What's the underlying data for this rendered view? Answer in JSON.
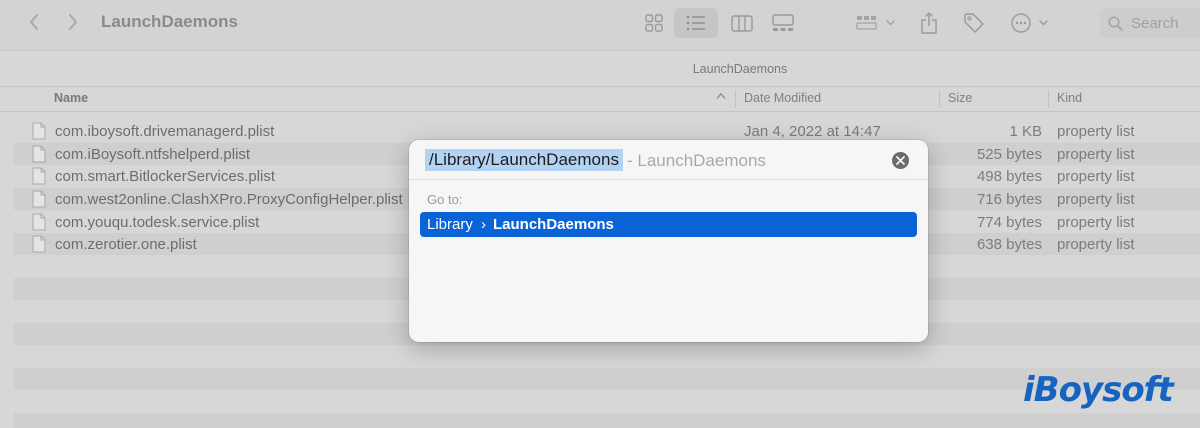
{
  "window": {
    "title": "LaunchDaemons",
    "path_bar": "LaunchDaemons",
    "search_placeholder": "Search"
  },
  "toolbar": {
    "icons": [
      "chevron-left-icon",
      "chevron-right-icon",
      "icon-view-icon",
      "list-view-icon",
      "column-view-icon",
      "gallery-view-icon",
      "group-icon",
      "share-icon",
      "tag-icon",
      "more-actions-icon",
      "search-icon"
    ],
    "active_view": "list-view"
  },
  "columns": {
    "name": "Name",
    "date_modified": "Date Modified",
    "size": "Size",
    "kind": "Kind"
  },
  "files": [
    {
      "name": "com.iboysoft.drivemanagerd.plist",
      "date": "Jan 4, 2022 at 14:47",
      "size": "1 KB",
      "kind": "property list"
    },
    {
      "name": "com.iBoysoft.ntfshelperd.plist",
      "date": "",
      "size": "525 bytes",
      "kind": "property list"
    },
    {
      "name": "com.smart.BitlockerServices.plist",
      "date": "",
      "size": "498 bytes",
      "kind": "property list"
    },
    {
      "name": "com.west2online.ClashXPro.ProxyConfigHelper.plist",
      "date": "",
      "size": "716 bytes",
      "kind": "property list"
    },
    {
      "name": "com.youqu.todesk.service.plist",
      "date": "",
      "size": "774 bytes",
      "kind": "property list"
    },
    {
      "name": "com.zerotier.one.plist",
      "date": "",
      "size": "638 bytes",
      "kind": "property list"
    }
  ],
  "goto_dialog": {
    "typed_path": "/Library/LaunchDaemons",
    "completion": "- LaunchDaemons",
    "section_label": "Go to:",
    "result_parent": "Library",
    "result_separator": "›",
    "result_folder": "LaunchDaemons"
  },
  "watermark": {
    "text": "iBoysoft",
    "color": "#1664c0"
  },
  "colors": {
    "selection_highlight": "#0a64d6",
    "text_selection": "#b3d3f5"
  }
}
